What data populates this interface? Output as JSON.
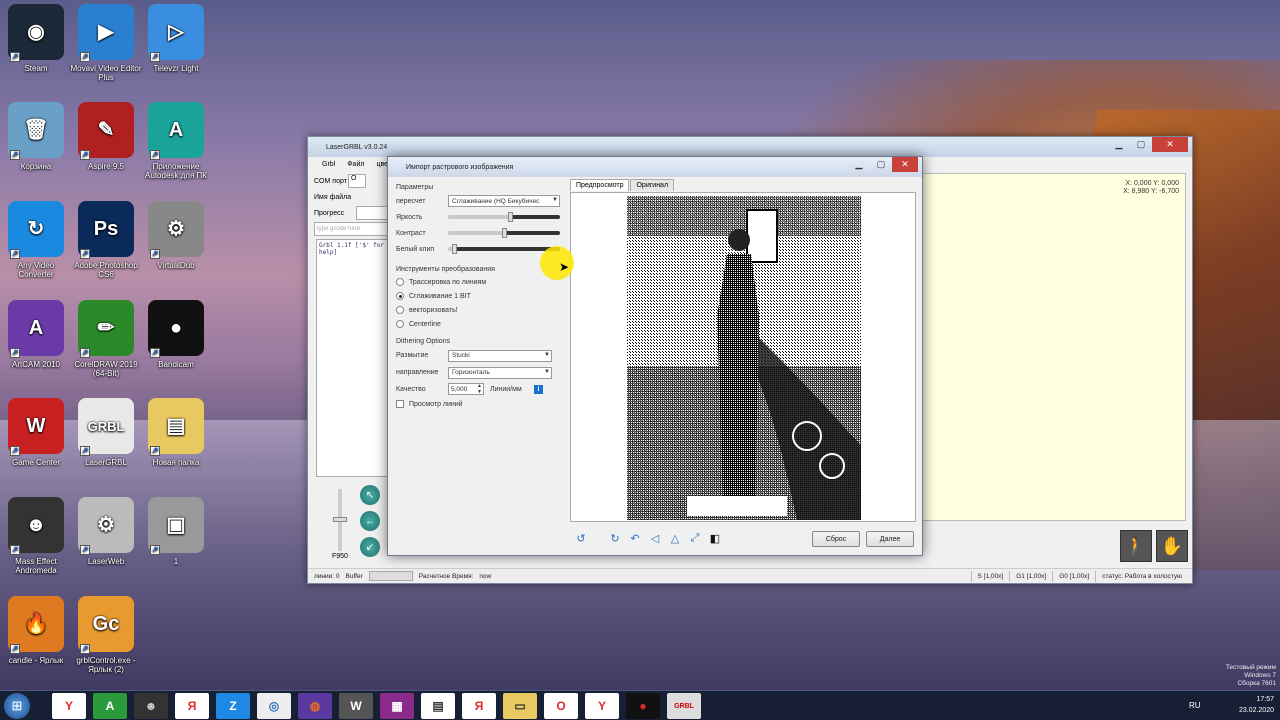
{
  "desktop": {
    "icons": [
      {
        "label": "Steam",
        "icon": "steam-icon",
        "color": "#1b2838",
        "glyph": "◉"
      },
      {
        "label": "Movavi Video Editor Plus",
        "icon": "movavi-icon",
        "color": "#2a7fd0",
        "glyph": "▶"
      },
      {
        "label": "Televzr Light",
        "icon": "televzr-icon",
        "color": "#3a8ee0",
        "glyph": "▷"
      },
      {
        "label": "Корзина",
        "icon": "recycle-bin-icon",
        "color": "#6aa0c8",
        "glyph": "🗑"
      },
      {
        "label": "Aspire 9.5",
        "icon": "aspire-icon",
        "color": "#b02020",
        "glyph": "✎"
      },
      {
        "label": "Приложение Autodesk для ПК",
        "icon": "autodesk-icon",
        "color": "#1aa39a",
        "glyph": "A"
      },
      {
        "label": "Any Video Converter",
        "icon": "any-video-converter-icon",
        "color": "#1a8ae0",
        "glyph": "↻"
      },
      {
        "label": "Adobe Photoshop CS6",
        "icon": "photoshop-icon",
        "color": "#0a2a5a",
        "glyph": "Ps"
      },
      {
        "label": "VirtualDub",
        "icon": "virtualdub-icon",
        "color": "#888",
        "glyph": "⚙"
      },
      {
        "label": "ArtCAM 2010",
        "icon": "artcam-icon",
        "color": "#6a3aa8",
        "glyph": "A"
      },
      {
        "label": "CorelDRAW 2019 (64-Bit)",
        "icon": "coreldraw-icon",
        "color": "#2a8a2a",
        "glyph": "✏"
      },
      {
        "label": "Bandicam",
        "icon": "bandicam-icon",
        "color": "#111",
        "glyph": "●"
      },
      {
        "label": "Game Center",
        "icon": "game-center-icon",
        "color": "#c82020",
        "glyph": "W"
      },
      {
        "label": "LaserGRBL",
        "icon": "lasergrbl-icon",
        "color": "#e8e8e8",
        "glyph": "GRBL"
      },
      {
        "label": "Новая папка",
        "icon": "folder-icon",
        "color": "#e8c860",
        "glyph": "▤"
      },
      {
        "label": "Mass Effect Andromeda",
        "icon": "mass-effect-icon",
        "color": "#333",
        "glyph": "☻"
      },
      {
        "label": "LaserWeb",
        "icon": "laserweb-icon",
        "color": "#bbb",
        "glyph": "⚙"
      },
      {
        "label": "1",
        "icon": "image-file-icon",
        "color": "#999",
        "glyph": "▣"
      },
      {
        "label": "candle - Ярлык",
        "icon": "candle-icon",
        "color": "#e07a20",
        "glyph": "🔥"
      },
      {
        "label": "grblControl.exe - Ярлык (2)",
        "icon": "grblcontrol-icon",
        "color": "#e89a30",
        "glyph": "Gc"
      }
    ]
  },
  "lasergrbl": {
    "title": "LaserGRBL v3.0.24",
    "menu": [
      "Grbl",
      "Файл",
      "цвет"
    ],
    "com_port_label": "COM порт",
    "com_port_value": "O",
    "filename_label": "Имя файла",
    "progress_label": "Прогресс",
    "gcode_placeholder": "type gcode here",
    "log_line": "Grbl 1.1f ['$' for help]",
    "coords_line1": "X: 0,000 Y: 0,000",
    "coords_line2": "X: 8,980 Y: -6,700",
    "speed_label": "F950",
    "status": {
      "lines": "линии: 0",
      "buffer": "Buffer",
      "estimated_label": "Расчетное Время:",
      "estimated_value": "now",
      "s": "S [1,00x]",
      "g1": "G1 [1,00x]",
      "g0": "G0 [1,00x]",
      "state": "статус: Работа в холостую"
    }
  },
  "dialog": {
    "title": "Импорт растрового изображения",
    "params_header": "Параметры",
    "resample_label": "пересчет",
    "resample_value": "Сглаживание (HQ Бикубичес",
    "brightness_label": "Яркость",
    "contrast_label": "Контраст",
    "whiteclip_label": "Белый клип",
    "brightness": 0.55,
    "contrast": 0.5,
    "whiteclip": 0.05,
    "tools_header": "Инструменты преобразования",
    "modes": [
      "Трассировка по линиям",
      "Сглаживание 1 BIT",
      "векторизовать!",
      "Centerline"
    ],
    "selected_mode": 1,
    "dither_header": "Dithering Options",
    "blur_label": "Размытие",
    "blur_value": "Stucki",
    "direction_label": "направление",
    "direction_value": "Горизонталь",
    "quality_label": "Качество",
    "quality_value": "5,000",
    "quality_unit": "Линии/мм",
    "preview_lines_label": "Просмотр линий",
    "tab_preview": "Предпросмотр",
    "tab_original": "Оригинал",
    "reset_button": "Сброс",
    "next_button": "Далее"
  },
  "taskbar": {
    "lang": "RU",
    "time": "17:57",
    "date": "23.02.2020",
    "apps": [
      {
        "name": "yandex-browser-icon",
        "glyph": "Y",
        "color": "#e02a2a",
        "bg": "#fff"
      },
      {
        "name": "autodesk-app-icon",
        "glyph": "A",
        "color": "#fff",
        "bg": "#2a9a3a"
      },
      {
        "name": "mass-effect-taskbar-icon",
        "glyph": "☻",
        "color": "#ccc",
        "bg": "#333"
      },
      {
        "name": "yandex-icon",
        "glyph": "Я",
        "color": "#e02a2a",
        "bg": "#fff"
      },
      {
        "name": "zoom-app-icon",
        "glyph": "Z",
        "color": "#fff",
        "bg": "#1e88e5"
      },
      {
        "name": "chrome-icon",
        "glyph": "◎",
        "color": "#2a6fc0",
        "bg": "#eee"
      },
      {
        "name": "firefox-icon",
        "glyph": "◍",
        "color": "#e86a20",
        "bg": "#5a3aa0"
      },
      {
        "name": "world-of-tanks-icon",
        "glyph": "W",
        "color": "#fff",
        "bg": "#555"
      },
      {
        "name": "winrar-icon",
        "glyph": "▦",
        "color": "#fff",
        "bg": "#8a2a8a"
      },
      {
        "name": "notepad-icon",
        "glyph": "▤",
        "color": "#333",
        "bg": "#fff"
      },
      {
        "name": "yandex-taskbar-icon",
        "glyph": "Я",
        "color": "#e02a2a",
        "bg": "#fff"
      },
      {
        "name": "explorer-folder-icon",
        "glyph": "▭",
        "color": "#333",
        "bg": "#e8c860"
      },
      {
        "name": "opera-icon",
        "glyph": "O",
        "color": "#e02a2a",
        "bg": "#fff"
      },
      {
        "name": "yandex-browser-taskbar-icon",
        "glyph": "Y",
        "color": "#e02a2a",
        "bg": "#fff"
      },
      {
        "name": "bandicam-taskbar-icon",
        "glyph": "●",
        "color": "#e02a2a",
        "bg": "#111"
      },
      {
        "name": "lasergrbl-taskbar-icon",
        "glyph": "GRBL",
        "color": "#c00",
        "bg": "#ddd"
      }
    ]
  },
  "watermark": {
    "line1": "Тестовый режим",
    "line2": "Windows 7",
    "line3": "Сборка 7601"
  }
}
